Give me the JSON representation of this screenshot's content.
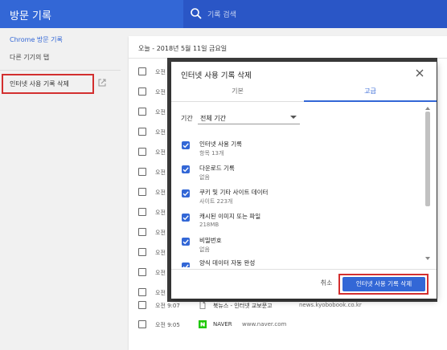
{
  "header": {
    "title": "방문 기록",
    "search_placeholder": "기록 검색",
    "icon": "search-icon"
  },
  "sidebar": {
    "items": [
      {
        "label": "Chrome 방문 기록",
        "active": true
      },
      {
        "label": "다른 기기의 탭",
        "active": false
      }
    ],
    "clear_label": "인터넷 사용 기록 삭제",
    "clear_icon": "external-link-icon"
  },
  "history": {
    "date_header": "오늘 - 2018년 5월 11일 금요일",
    "rows": [
      {
        "time": "오전"
      },
      {
        "time": "오전"
      },
      {
        "time": "오전"
      },
      {
        "time": "오전"
      },
      {
        "time": "오전"
      },
      {
        "time": "오전"
      },
      {
        "time": "오전"
      },
      {
        "time": "오전"
      },
      {
        "time": "오전"
      },
      {
        "time": "오전"
      },
      {
        "time": "오전"
      },
      {
        "time": "오전"
      },
      {
        "time": "오전 9:07",
        "title": "북뉴스 - 인터넷 교보문고",
        "url": "news.kyobobook.co.kr",
        "icon": "document-icon"
      },
      {
        "time": "오전 9:05",
        "title": "NAVER",
        "url": "www.naver.com",
        "icon": "naver-icon"
      }
    ]
  },
  "dialog": {
    "title": "인터넷 사용 기록 삭제",
    "tabs": [
      {
        "label": "기본",
        "active": false
      },
      {
        "label": "고급",
        "active": true
      }
    ],
    "range_label": "기간",
    "range_value": "전체 기간",
    "options": [
      {
        "title": "인터넷 사용 기록",
        "subtitle": "항목 13개",
        "checked": true
      },
      {
        "title": "다운로드 기록",
        "subtitle": "없음",
        "checked": true
      },
      {
        "title": "쿠키 및 기타 사이트 데이터",
        "subtitle": "사이트 223개",
        "checked": true
      },
      {
        "title": "캐시된 이미지 또는 파일",
        "subtitle": "218MB",
        "checked": true
      },
      {
        "title": "비밀번호",
        "subtitle": "없음",
        "checked": true
      },
      {
        "title": "양식 데이터 자동 완성",
        "subtitle": "",
        "checked": true
      }
    ],
    "cancel_label": "취소",
    "confirm_label": "인터넷 사용 기록 삭제"
  },
  "colors": {
    "accent": "#3367d6",
    "highlight": "#d32f2f",
    "overlay": "#3c3c3c"
  }
}
